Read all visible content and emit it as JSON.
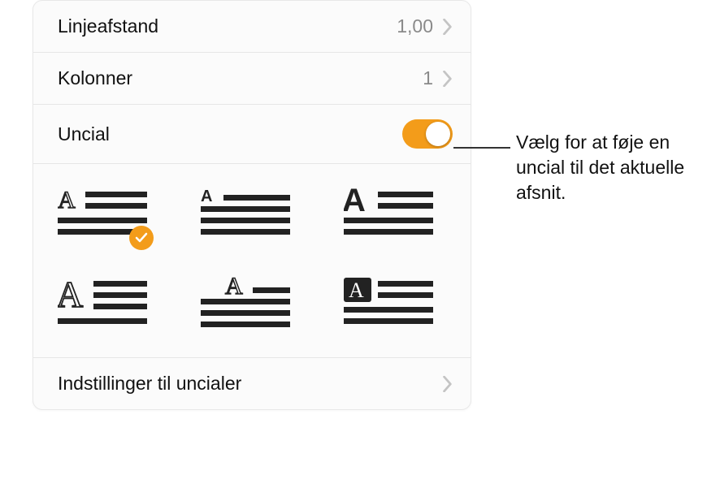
{
  "rows": {
    "lineSpacing": {
      "label": "Linjeafstand",
      "value": "1,00"
    },
    "columns": {
      "label": "Kolonner",
      "value": "1"
    },
    "uncial": {
      "label": "Uncial"
    },
    "settings": {
      "label": "Indstillinger til uncialer"
    }
  },
  "callout": "Vælg for at føje en uncial til det aktuelle afsnit.",
  "colors": {
    "accent": "#f39c1a"
  }
}
